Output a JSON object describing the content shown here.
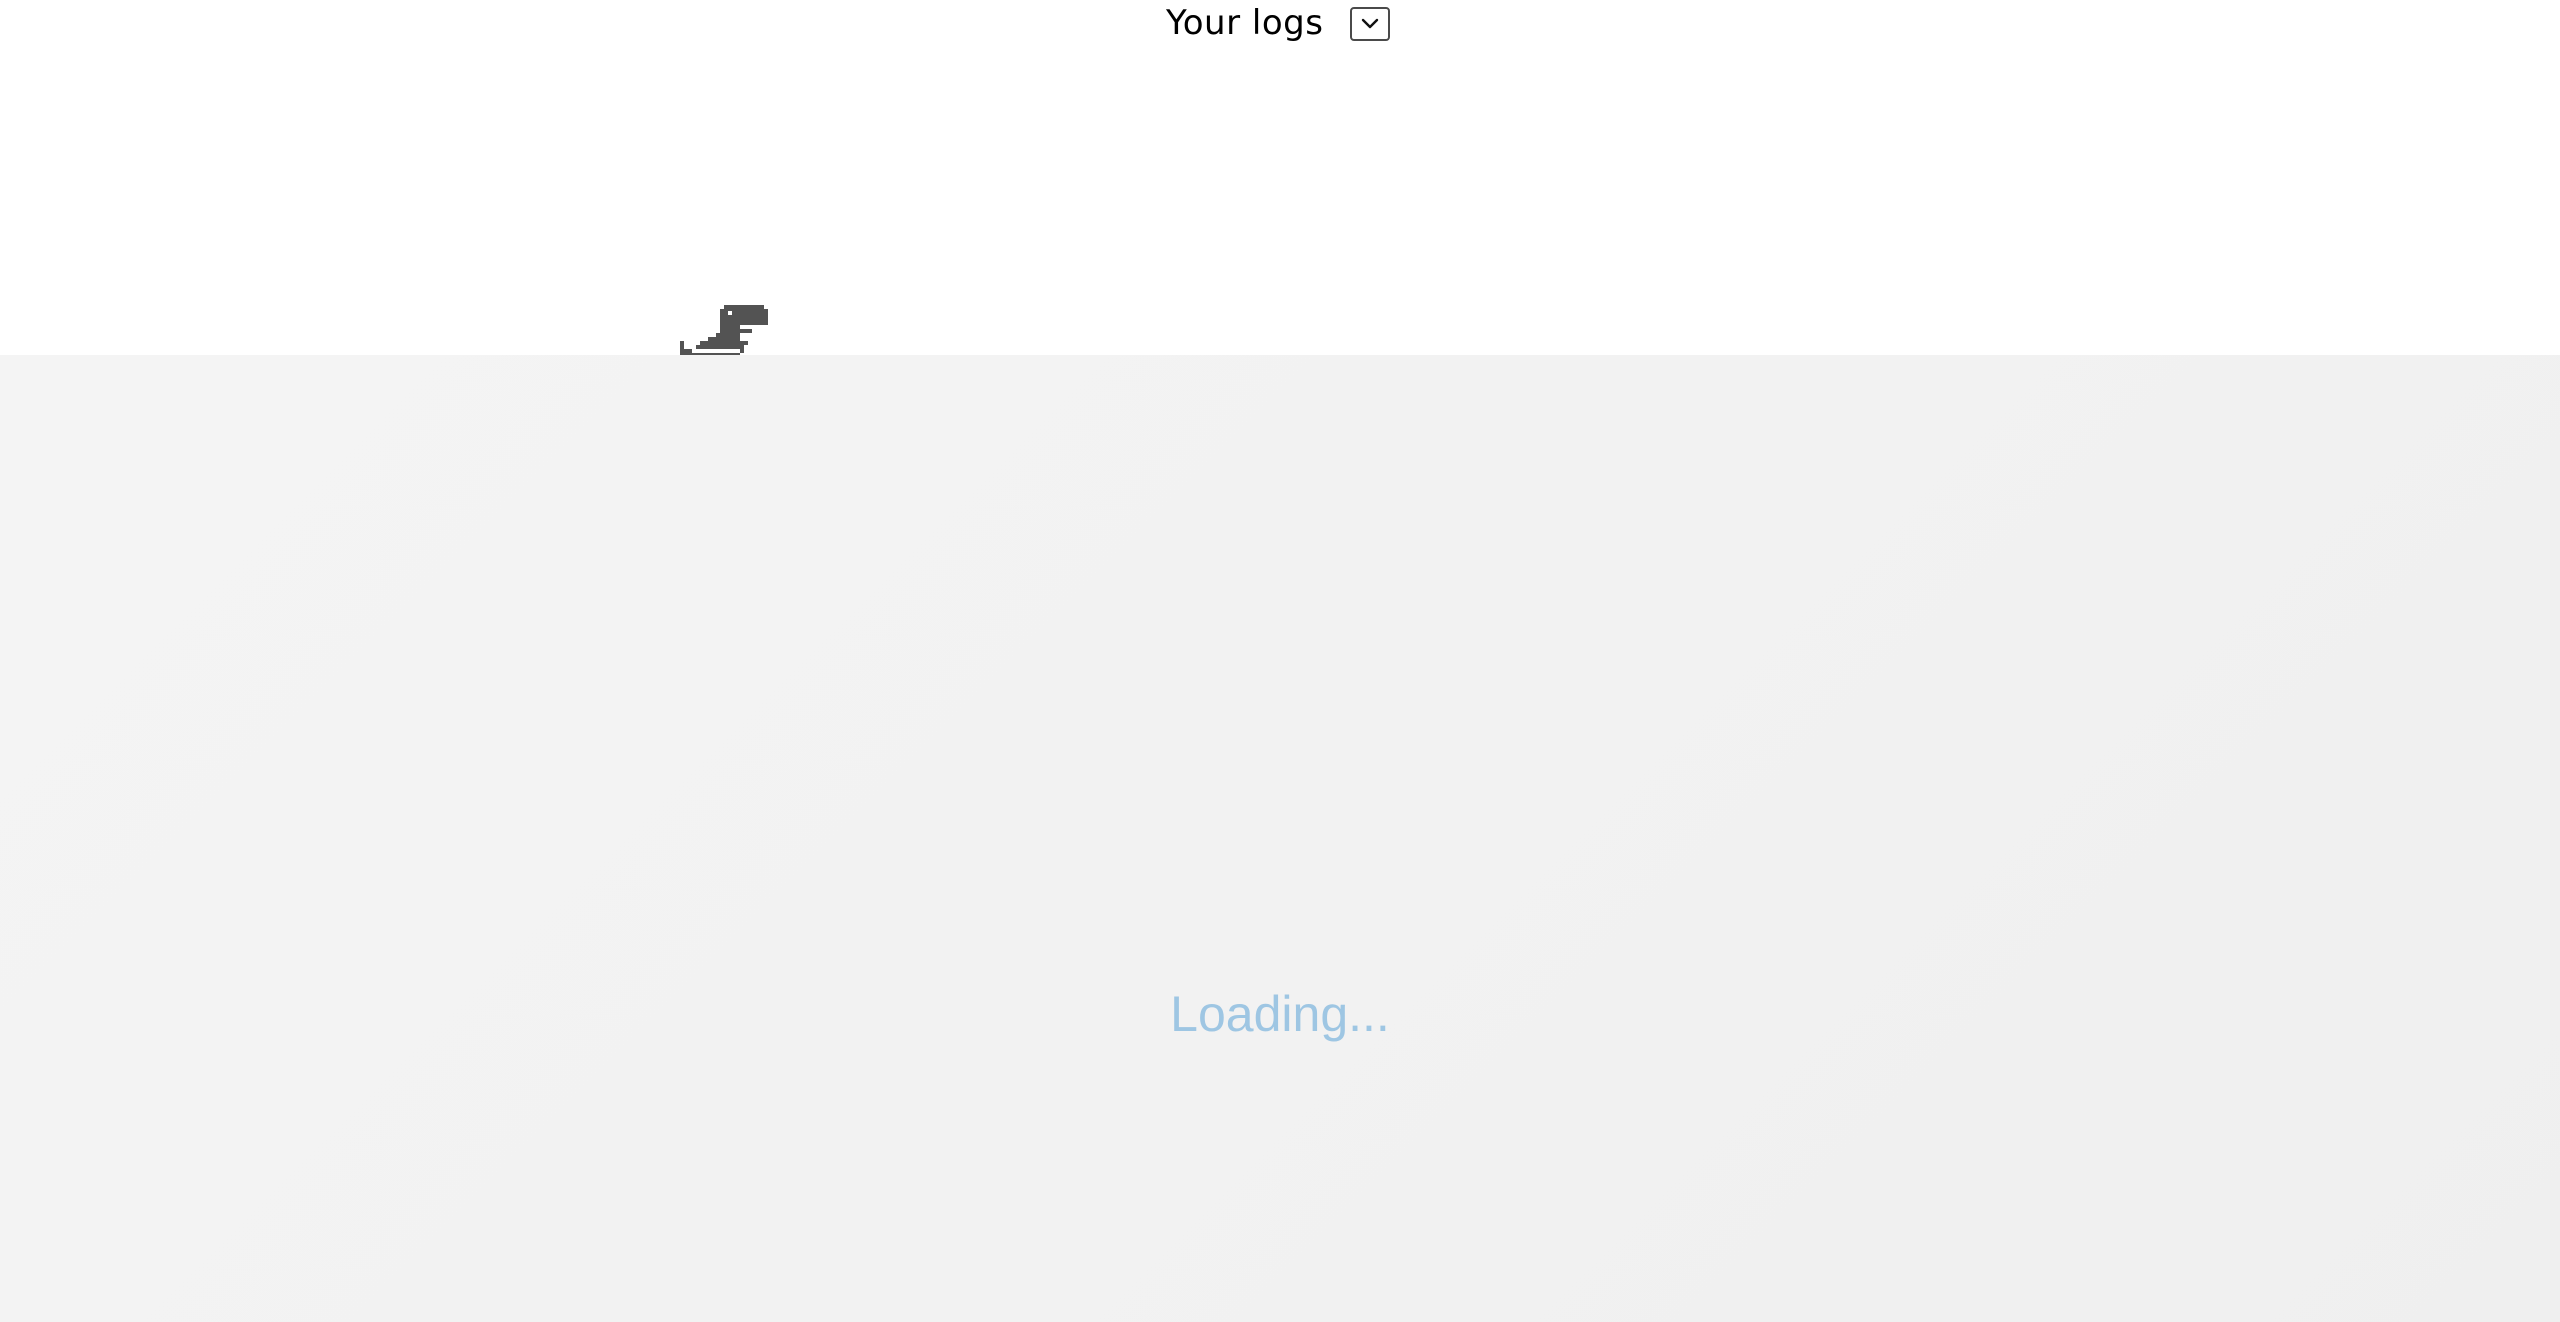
{
  "header": {
    "title": "Your logs",
    "select_icon": "chevron-down-icon"
  },
  "game": {
    "sprite": "t-rex-dino-icon",
    "sprite_color": "#535353"
  },
  "loading": {
    "text": "Loading...",
    "color": "#9ec6e3"
  },
  "colors": {
    "page_background": "#ffffff",
    "panel_background": "#f2f2f2"
  }
}
